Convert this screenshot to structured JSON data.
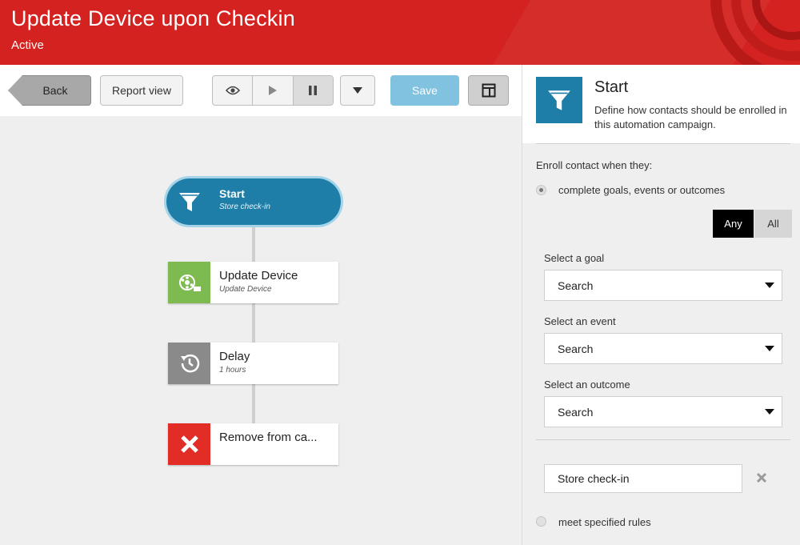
{
  "header": {
    "title": "Update Device upon Checkin",
    "status": "Active",
    "brand_color": "#d3221f"
  },
  "toolbar": {
    "back_label": "Back",
    "report_label": "Report view",
    "preview_icon": "eye-icon",
    "play_icon": "play-icon",
    "pause_icon": "pause-icon",
    "dropdown_icon": "caret-down-icon",
    "save_label": "Save",
    "layout_icon": "layout-icon"
  },
  "flow": {
    "nodes": [
      {
        "title": "Start",
        "subtitle": "Store check-in",
        "icon": "funnel-icon",
        "color": "#1e7ea8"
      },
      {
        "title": "Update Device",
        "subtitle": "Update Device",
        "icon": "device-update-icon",
        "color": "#7dba4f"
      },
      {
        "title": "Delay",
        "subtitle": "1 hours",
        "icon": "delay-clock-icon",
        "color": "#8a8a8a"
      },
      {
        "title": "Remove from ca...",
        "subtitle": "",
        "icon": "remove-x-icon",
        "color": "#e12d25"
      }
    ]
  },
  "panel": {
    "title": "Start",
    "description": "Define how contacts should be enrolled in this automation campaign.",
    "enroll_label": "Enroll contact when they:",
    "option_goals": "complete goals, events or outcomes",
    "option_rules": "meet specified rules",
    "toggle_any": "Any",
    "toggle_all": "All",
    "goal_label": "Select a goal",
    "goal_placeholder": "Search",
    "event_label": "Select an event",
    "event_placeholder": "Search",
    "outcome_label": "Select an outcome",
    "outcome_placeholder": "Search",
    "selected_item": "Store check-in"
  }
}
